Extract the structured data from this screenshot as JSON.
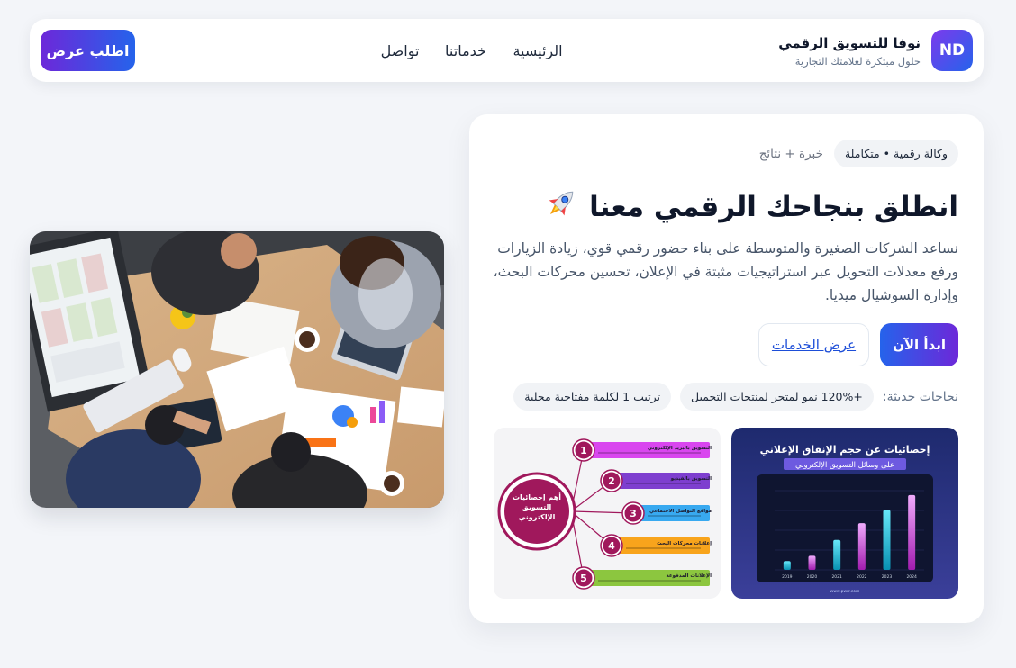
{
  "nav": {
    "cta_label": "اطلب عرض",
    "links": [
      "تواصل",
      "خدماتنا",
      "الرئيسية"
    ],
    "brand_name": "نوفا للتسويق الرقمي",
    "brand_tagline": "حلول مبتكرة لعلامتك التجارية",
    "logo_text": "ND"
  },
  "hero": {
    "pill": "وكالة رقمية • متكاملة",
    "kicker": "خبرة + نتائج",
    "headline": "انطلق بنجاحك الرقمي معنا",
    "headline_icon": "rocket-icon",
    "description": "نساعد الشركات الصغيرة والمتوسطة على بناء حضور رقمي قوي، زيادة الزيارات ورفع معدلات التحويل عبر استراتيجيات مثبتة في الإعلان، تحسين محركات البحث، وإدارة السوشيال ميديا.",
    "primary_button": "ابدأ الآن",
    "secondary_button": "عرض الخدمات",
    "success_label": "نجاحات حديثة:",
    "success_items": [
      "+120% نمو لمتجر لمنتجات التجميل",
      "ترتيب 1 لكلمة مفتاحية محلية"
    ]
  },
  "infographic_bar": {
    "title": "إحصائيات عن حجم الإنفاق الإعلاني",
    "subtitle": "على وسائل التسويق الإلكتروني",
    "years": [
      "2019",
      "2020",
      "2021",
      "2022",
      "2023",
      "2024"
    ],
    "values": [
      1,
      1.6,
      3.4,
      5.3,
      6.8,
      8.5
    ],
    "footer": "www.pwrr.com"
  },
  "infographic_mindmap": {
    "center": "أهم إحصائيات التسويق الإلكتروني",
    "items": [
      {
        "n": "1",
        "label": "التسويق بالبريد الإلكتروني",
        "color": "#d946ef"
      },
      {
        "n": "2",
        "label": "التسويق بالفيديو",
        "color": "#7e3fcf"
      },
      {
        "n": "3",
        "label": "مواقع التواصل الاجتماعي",
        "color": "#38a9f0"
      },
      {
        "n": "4",
        "label": "إعلانات محركات البحث",
        "color": "#f8a41c"
      },
      {
        "n": "5",
        "label": "الإعلانات المدفوعة",
        "color": "#8cc63f"
      }
    ]
  },
  "colors": {
    "accent_purple": "#6d28d9",
    "accent_blue": "#2563eb",
    "page_bg": "#f3f5f9",
    "magenta": "#a0185c"
  }
}
